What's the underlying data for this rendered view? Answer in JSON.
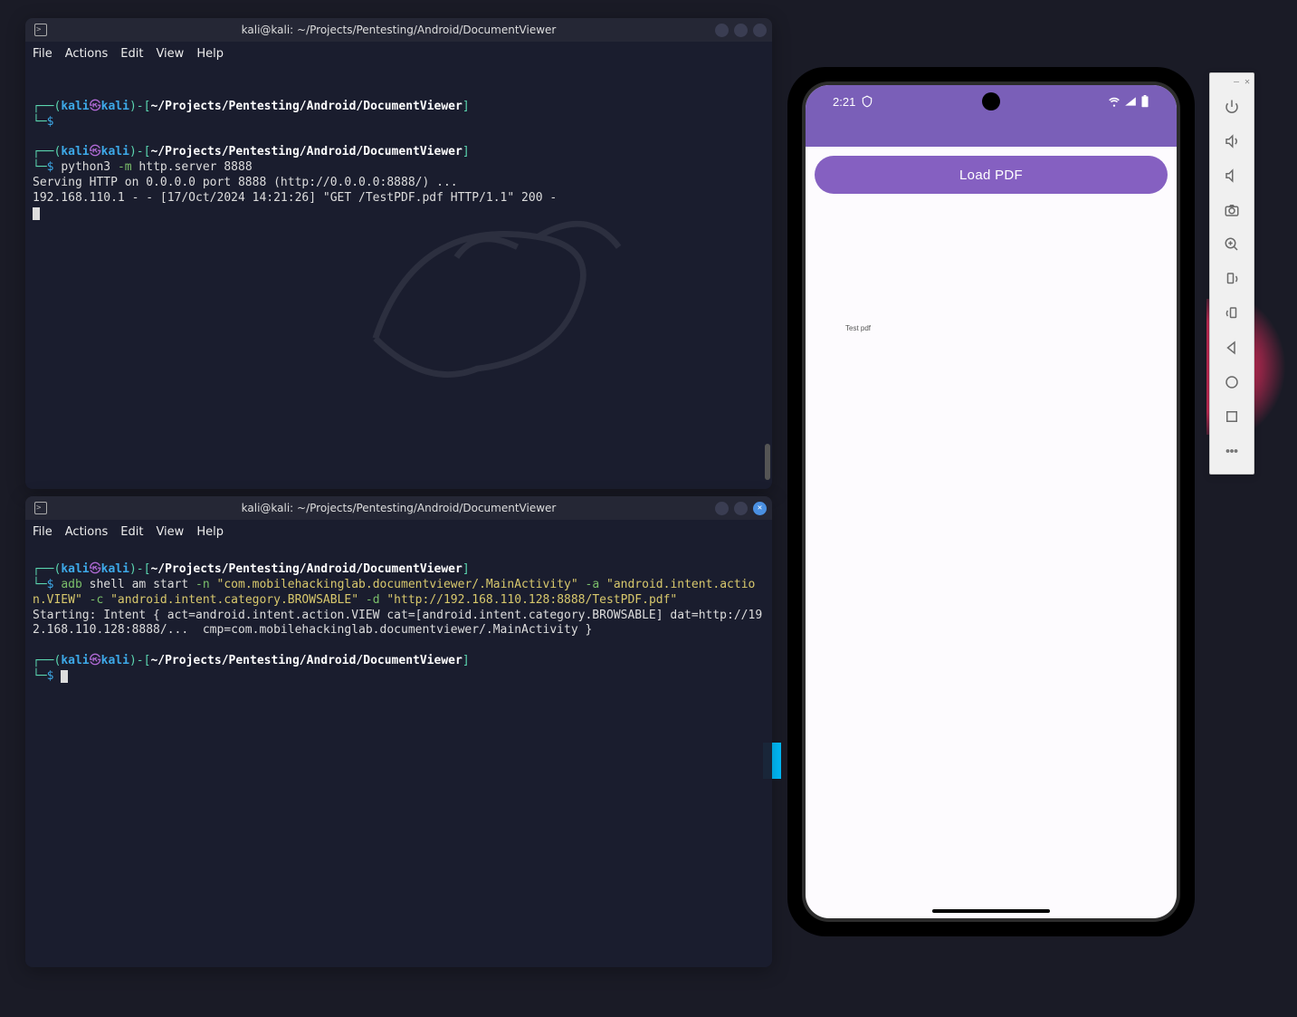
{
  "terminal1": {
    "title": "kali@kali: ~/Projects/Pentesting/Android/DocumentViewer",
    "menu": [
      "File",
      "Actions",
      "Edit",
      "View",
      "Help"
    ],
    "prompt_user": "kali",
    "prompt_host": "kali",
    "prompt_path": "~/Projects/Pentesting/Android/DocumentViewer",
    "cmd1": "python3 ",
    "cmd1_flag": "-m",
    "cmd1_rest": " http.server 8888",
    "out1": "Serving HTTP on 0.0.0.0 port 8888 (http://0.0.0.0:8888/) ...",
    "out2": "192.168.110.1 - - [17/Oct/2024 14:21:26] \"GET /TestPDF.pdf HTTP/1.1\" 200 -"
  },
  "terminal2": {
    "title": "kali@kali: ~/Projects/Pentesting/Android/DocumentViewer",
    "menu": [
      "File",
      "Actions",
      "Edit",
      "View",
      "Help"
    ],
    "prompt_user": "kali",
    "prompt_host": "kali",
    "prompt_path": "~/Projects/Pentesting/Android/DocumentViewer",
    "cmd_adb": "adb",
    "cmd_rest1": " shell am start ",
    "flag_n": "-n",
    "arg_n": " \"com.mobilehackinglab.documentviewer/.MainActivity\" ",
    "flag_a": "-a",
    "arg_a": " \"android.intent.action.VIEW\" ",
    "flag_c": "-c",
    "arg_c": " \"android.intent.category.BROWSABLE\" ",
    "flag_d": "-d",
    "arg_d": " \"http://192.168.110.128:8888/TestPDF.pdf\"",
    "out1": "Starting: Intent { act=android.intent.action.VIEW cat=[android.intent.category.BROWSABLE] dat=http://192.168.110.128:8888/...  cmp=com.mobilehackinglab.documentviewer/.MainActivity }"
  },
  "emulator": {
    "time": "2:21",
    "button_label": "Load PDF",
    "content_label": "Test pdf"
  },
  "emu_toolbar": {
    "items": [
      "power",
      "vol-up",
      "vol-down",
      "camera",
      "zoom",
      "rotate-ccw",
      "rotate-cw",
      "back",
      "home",
      "overview",
      "more"
    ]
  }
}
